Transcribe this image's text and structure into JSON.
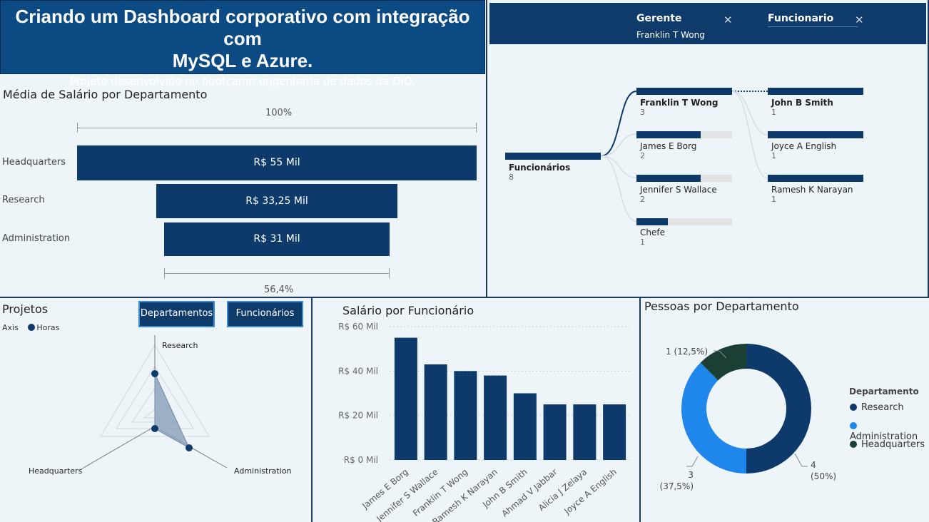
{
  "header": {
    "title_line1": "Criando um Dashboard corporativo com integração com",
    "title_line2": "MySQL e Azure.",
    "subtitle": "Projeto desenvolvido no bootcamp engenharia de dados da DIO."
  },
  "filters": {
    "gerente_label": "Gerente",
    "gerente_value": "Franklin T Wong",
    "funcionario_label": "Funcionario",
    "close_glyph": "✕"
  },
  "funnel": {
    "title": "Média de Salário por Departamento",
    "top_pct": "100%",
    "bottom_pct": "56,4%",
    "rows": [
      {
        "label": "Headquarters",
        "value_text": "R$ 55 Mil",
        "value": 55000
      },
      {
        "label": "Research",
        "value_text": "R$ 33,25 Mil",
        "value": 33250
      },
      {
        "label": "Administration",
        "value_text": "R$ 31 Mil",
        "value": 31000
      }
    ]
  },
  "tree": {
    "root": {
      "label": "Funcionários",
      "count": "8"
    },
    "level1": [
      {
        "label": "Franklin T Wong",
        "count": "3",
        "fill": 1.0,
        "bold": true
      },
      {
        "label": "James E Borg",
        "count": "2",
        "fill": 0.67
      },
      {
        "label": "Jennifer S Wallace",
        "count": "2",
        "fill": 0.67
      },
      {
        "label": "Chefe",
        "count": "1",
        "fill": 0.33
      }
    ],
    "level2": [
      {
        "label": "John B Smith",
        "count": "1",
        "fill": 1.0,
        "bold": true
      },
      {
        "label": "Joyce A English",
        "count": "1",
        "fill": 1.0
      },
      {
        "label": "Ramesh K Narayan",
        "count": "1",
        "fill": 1.0
      }
    ]
  },
  "projetos": {
    "title": "Projetos",
    "legend_axis": "Axis",
    "legend_series": "Horas",
    "btn_departamentos": "Departamentos",
    "btn_funcionarios": "Funcionários",
    "axes": [
      "Research",
      "Administration",
      "Headquarters"
    ]
  },
  "chart_data": [
    {
      "type": "bar",
      "title": "Salário por Funcionário",
      "categories": [
        "James E Borg",
        "Jennifer S Wallace",
        "Franklin T Wong",
        "Ramesh K Narayan",
        "John B Smith",
        "Ahmad V Jabbar",
        "Alicia J Zelaya",
        "Joyce A English"
      ],
      "values": [
        55000,
        43000,
        40000,
        38000,
        30000,
        25000,
        25000,
        25000
      ],
      "ylim": [
        0,
        60000
      ],
      "yticks": [
        "R$ 0 Mil",
        "R$ 20 Mil",
        "R$ 40 Mil",
        "R$ 60 Mil"
      ],
      "grid": true
    },
    {
      "type": "pie",
      "title": "Pessoas por Departamento",
      "legend_title": "Departamento",
      "legend_position": "right",
      "slices": [
        {
          "name": "Research",
          "value": 4,
          "label": "4",
          "pct_label": "(50%)",
          "color": "#0d3a6b"
        },
        {
          "name": "Administration",
          "value": 3,
          "label": "3",
          "pct_label": "(37,5%)",
          "color": "#1f86ec"
        },
        {
          "name": "Headquarters",
          "value": 1,
          "label": "1 (12,5%)",
          "pct_label": "",
          "color": "#1c3f35"
        }
      ]
    }
  ]
}
